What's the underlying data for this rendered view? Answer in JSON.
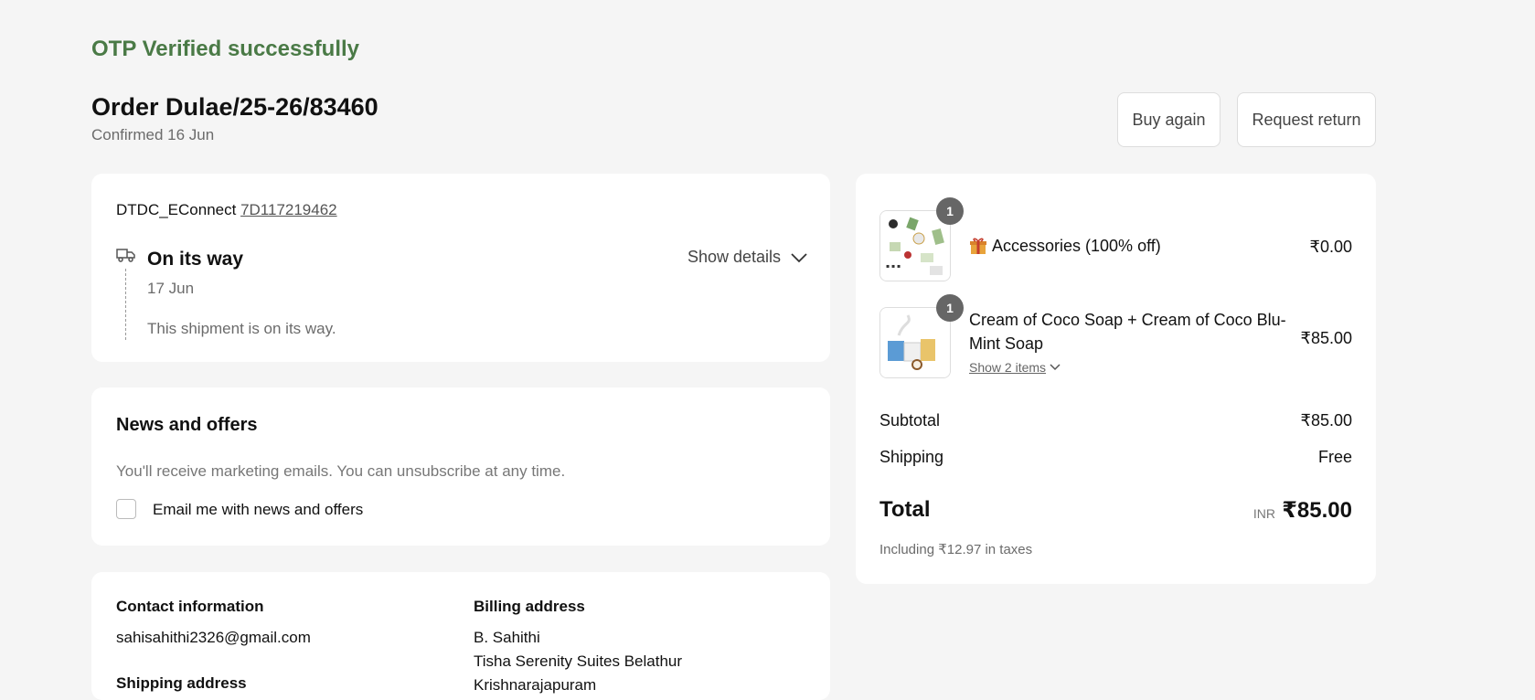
{
  "banner": {
    "otp_message": "OTP Verified successfully"
  },
  "order": {
    "title": "Order Dulae/25-26/83460",
    "confirmed": "Confirmed 16 Jun",
    "buy_again_label": "Buy again",
    "request_return_label": "Request return"
  },
  "shipment": {
    "carrier": "DTDC_EConnect",
    "tracking_number": "7D117219462",
    "status": "On its way",
    "date": "17 Jun",
    "description": "This shipment is on its way.",
    "show_details_label": "Show details"
  },
  "news": {
    "title": "News and offers",
    "description": "You'll receive marketing emails. You can unsubscribe at any time.",
    "checkbox_label": "Email me with news and offers"
  },
  "contact": {
    "contact_heading": "Contact information",
    "email": "sahisahithi2326@gmail.com",
    "shipping_heading": "Shipping address",
    "billing_heading": "Billing address",
    "billing_lines": [
      "B. Sahithi",
      "Tisha Serenity Suites Belathur",
      "Krishnarajapuram"
    ]
  },
  "summary": {
    "items": [
      {
        "quantity": "1",
        "icon": "gift-icon",
        "name": "Accessories (100% off)",
        "price": "₹0.00"
      },
      {
        "quantity": "1",
        "name_line1": "Cream of Coco Soap + Cream of Coco Blu-",
        "name_line2": "Mint Soap",
        "price": "₹85.00",
        "show_items_label": "Show 2 items"
      }
    ],
    "subtotal_label": "Subtotal",
    "subtotal_value": "₹85.00",
    "shipping_label": "Shipping",
    "shipping_value": "Free",
    "total_label": "Total",
    "currency": "INR",
    "total_value": "₹85.00",
    "taxes_note": "Including ₹12.97 in taxes"
  },
  "colors": {
    "accent": "#4a7a46",
    "background": "#f5f5f5",
    "card": "#ffffff"
  }
}
